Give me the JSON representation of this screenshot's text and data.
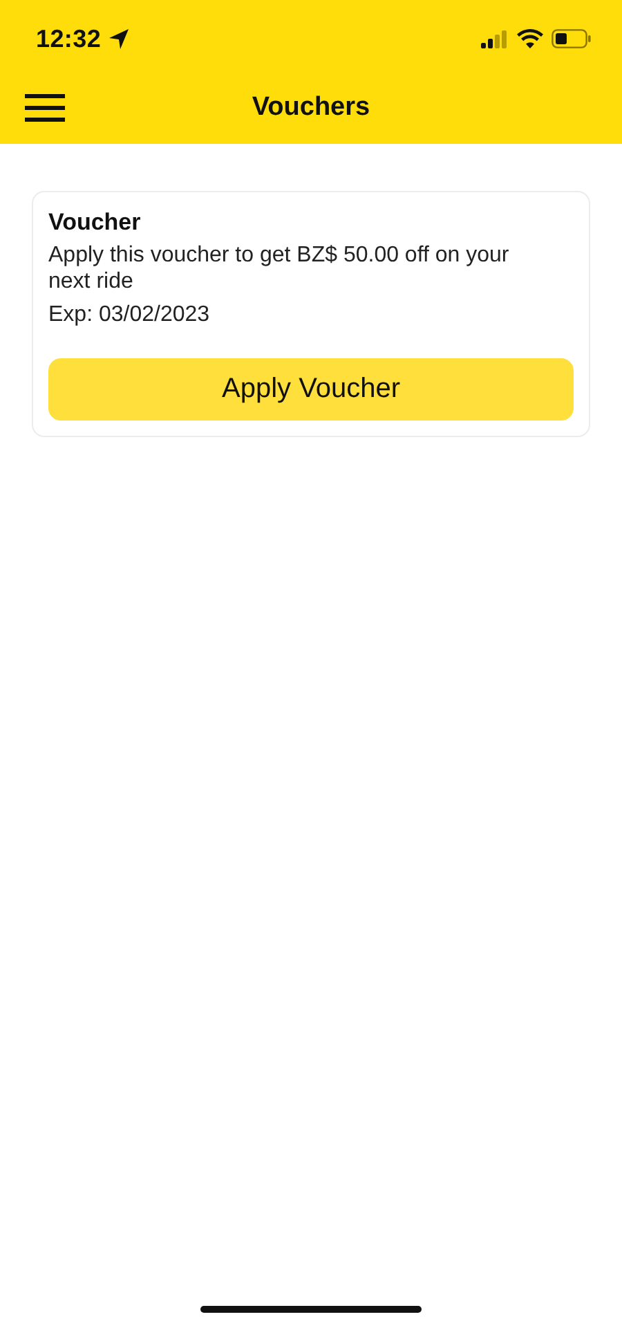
{
  "status_bar": {
    "time": "12:32"
  },
  "header": {
    "title": "Vouchers"
  },
  "vouchers": [
    {
      "title": "Voucher",
      "description": "Apply this voucher to get BZ$ 50.00 off on your next ride",
      "expiry": "Exp: 03/02/2023",
      "button": "Apply Voucher"
    }
  ]
}
